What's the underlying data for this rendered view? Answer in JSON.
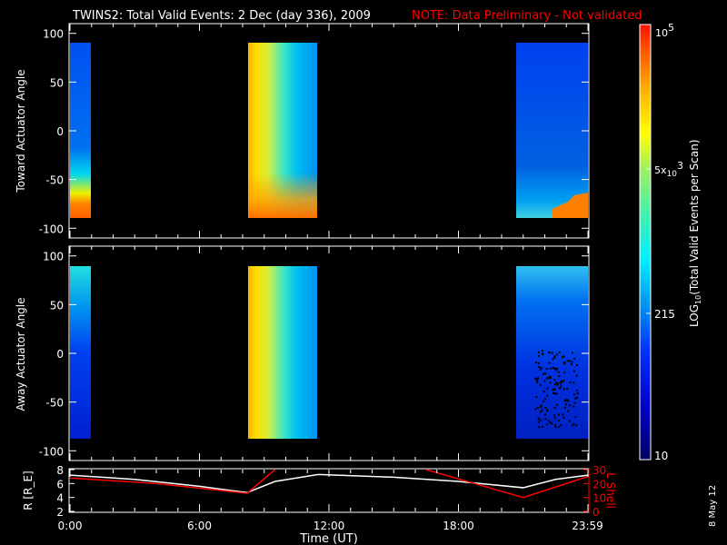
{
  "title": "TWINS2: Total Valid Events:  2 Dec (day 336), 2009",
  "note": "NOTE: Data Preliminary - Not validated",
  "side_stamp": "8 May 12",
  "colors": {
    "background": "#000000",
    "axes": "#ffffff",
    "note": "#ff0000",
    "r_line": "#ffffff",
    "lshell_line": "#ff0000"
  },
  "chart_data": [
    {
      "type": "heatmap",
      "name": "toward",
      "ylabel": "Toward Actuator Angle",
      "ylim": [
        -110,
        110
      ],
      "yticks": [
        100,
        50,
        0,
        -50,
        -100
      ],
      "xlim_hours": [
        0,
        24
      ],
      "data_blocks": [
        {
          "start_h": 0.0,
          "end_h": 0.97,
          "description_levels": {
            "top": 60,
            "bottom": 40000
          }
        },
        {
          "start_h": 8.25,
          "end_h": 11.45,
          "description_levels": {
            "left": 40000,
            "right": 200
          }
        },
        {
          "start_h": 20.65,
          "end_h": 23.99,
          "description_levels": {
            "top": 60,
            "bottom": 30000
          }
        }
      ],
      "angle_range": [
        -90,
        90
      ]
    },
    {
      "type": "heatmap",
      "name": "away",
      "ylabel": "Away Actuator Angle",
      "ylim": [
        -110,
        110
      ],
      "yticks": [
        100,
        50,
        0,
        -50,
        -100
      ],
      "xlim_hours": [
        0,
        24
      ],
      "data_blocks": [
        {
          "start_h": 0.0,
          "end_h": 0.97,
          "description_levels": {
            "top": 600,
            "bottom": 40
          }
        },
        {
          "start_h": 8.25,
          "end_h": 11.45,
          "description_levels": {
            "left": 40000,
            "right": 200
          }
        },
        {
          "start_h": 20.65,
          "end_h": 23.99,
          "description_levels": {
            "top": 400,
            "bottom": 30
          }
        }
      ],
      "angle_range": [
        -90,
        90
      ]
    },
    {
      "type": "line",
      "name": "orbit",
      "ylabel": "R [R_E]",
      "y2label": "L Shell",
      "xlabel": "Time (UT)",
      "xticklabels": [
        "0:00",
        "6:00",
        "12:00",
        "18:00",
        "23:59"
      ],
      "xtick_hours": [
        0,
        6,
        12,
        18,
        23.98
      ],
      "ylim": [
        2,
        8
      ],
      "yticks": [
        2,
        4,
        6,
        8
      ],
      "y2lim": [
        0,
        30
      ],
      "y2ticks": [
        0,
        10,
        20,
        30
      ],
      "series": [
        {
          "name": "R",
          "axis": "left",
          "x": [
            0,
            3,
            6,
            8.2,
            9.5,
            11.5,
            15,
            18,
            21,
            22.5,
            24
          ],
          "y": [
            7.2,
            6.6,
            5.6,
            4.7,
            6.3,
            7.3,
            6.9,
            6.3,
            5.4,
            6.6,
            7.2
          ]
        },
        {
          "name": "L Shell",
          "axis": "right",
          "x": [
            0,
            4,
            8.2,
            9.5
          ],
          "y": [
            24,
            20,
            13,
            30
          ]
        },
        {
          "name": "L Shell (2)",
          "axis": "right",
          "x": [
            16.5,
            21,
            24
          ],
          "y": [
            30,
            10,
            25
          ]
        }
      ]
    }
  ],
  "colorbar": {
    "label": "LOG10(Total Valid Events per Scan)",
    "label_main": "LOG",
    "label_sub": "10",
    "label_rest": "(Total Valid Events per Scan)",
    "ticks": [
      {
        "value": 100000,
        "label_base": "10",
        "label_exp": "5"
      },
      {
        "value": 5000,
        "label_pre": "5x",
        "label_base": "10",
        "label_exp": "3"
      },
      {
        "value": 215,
        "label": "215"
      },
      {
        "value": 10,
        "label": "10"
      }
    ],
    "range": [
      10,
      100000
    ]
  }
}
